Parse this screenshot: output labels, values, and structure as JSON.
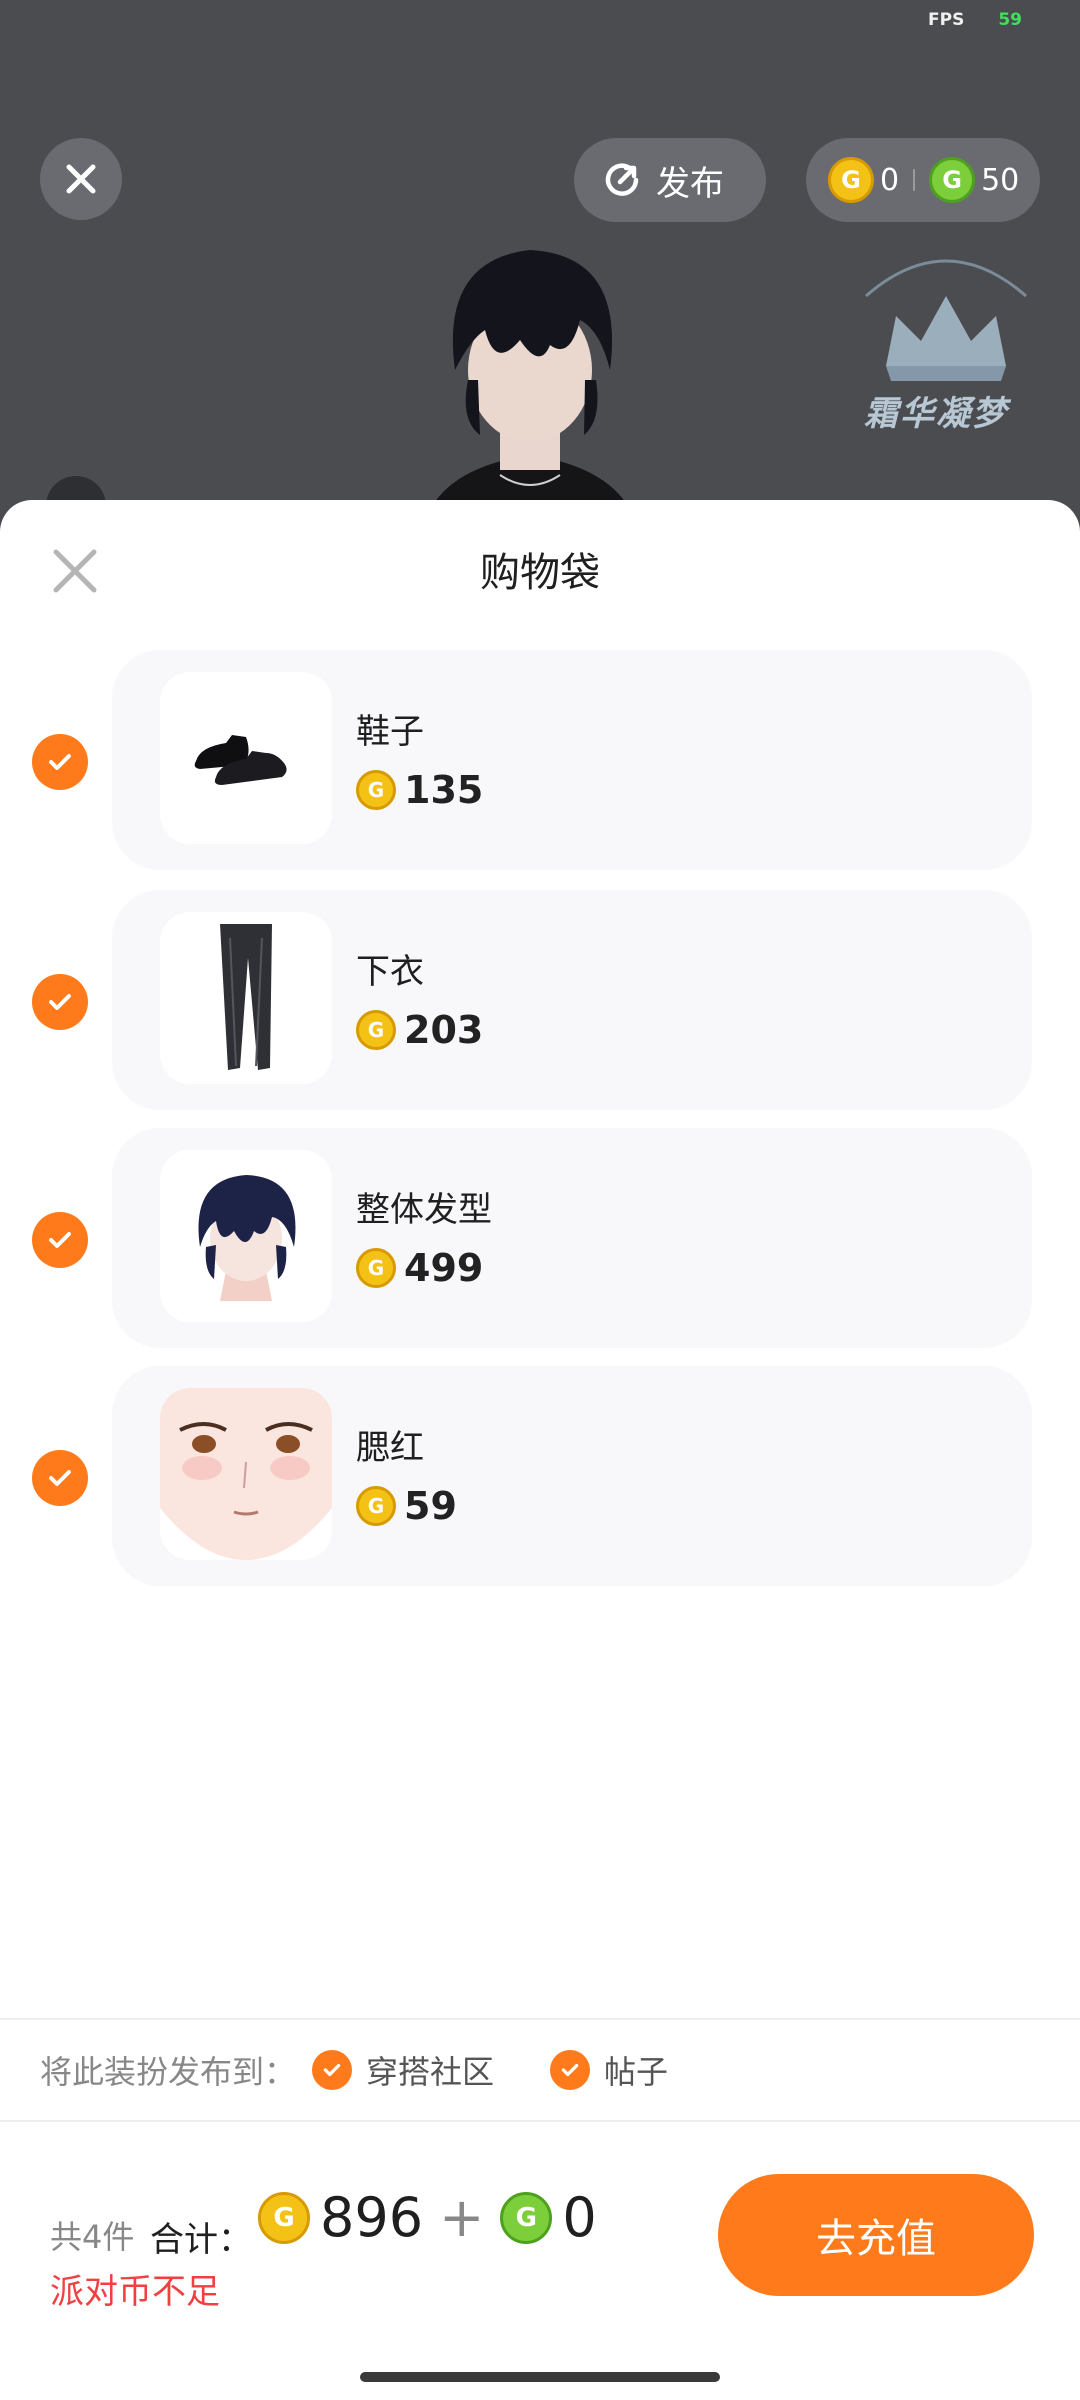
{
  "status": {
    "fps_label": "FPS",
    "fps_value": "59"
  },
  "top_bar": {
    "publish_label": "发布",
    "gold_balance": "0",
    "green_balance": "50"
  },
  "watermark": {
    "text": "霜华凝梦"
  },
  "sheet": {
    "title": "购物袋",
    "items": [
      {
        "name": "鞋子",
        "price": "135",
        "checked": true,
        "thumb": "shoes"
      },
      {
        "name": "下衣",
        "price": "203",
        "checked": true,
        "thumb": "pants"
      },
      {
        "name": "整体发型",
        "price": "499",
        "checked": true,
        "thumb": "hair"
      },
      {
        "name": "腮红",
        "price": "59",
        "checked": true,
        "thumb": "face"
      }
    ],
    "publish_to": {
      "label": "将此装扮发布到：",
      "options": [
        {
          "label": "穿搭社区",
          "checked": true
        },
        {
          "label": "帖子",
          "checked": true
        }
      ]
    },
    "summary": {
      "count_label": "共4件",
      "total_label": "合计：",
      "gold_total": "896",
      "plus": "+",
      "green_total": "0",
      "warning": "派对币不足",
      "recharge_label": "去充值"
    }
  },
  "colors": {
    "accent": "#ff7a1a",
    "warning": "#f04040",
    "card_bg": "#f8f7fa"
  }
}
